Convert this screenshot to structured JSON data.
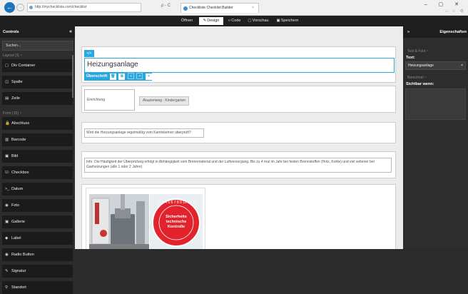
{
  "browser": {
    "url": "http://mychecklists.com/checklist",
    "address_tools": "ρ - C",
    "tab_title": "Checkliste Checklist Builder",
    "tab_close": "×",
    "window_controls": "–  ▢  ✕",
    "chrome_icons": "⌂ ☆ ⚙"
  },
  "toolbar": {
    "open": "Öffnen",
    "design": "Design",
    "code": "Code",
    "preview": "Vorschau",
    "save": "Speichern",
    "active": "design"
  },
  "left_panel": {
    "title": "Controls",
    "collapse": "«",
    "search_placeholder": "Suchen...",
    "layout_group": "Layout (3) ~",
    "layout_items": [
      {
        "icon": "div-container-icon",
        "glyph": "▢",
        "label": "Div Container"
      },
      {
        "icon": "columns-icon",
        "glyph": "◫",
        "label": "Spalte"
      },
      {
        "icon": "row-icon",
        "glyph": "▤",
        "label": "Zeile"
      }
    ],
    "form_group": "Form (15) ~",
    "form_items": [
      {
        "icon": "lock-icon",
        "glyph": "🔒",
        "label": "Abschluss"
      },
      {
        "icon": "barcode-icon",
        "glyph": "▥",
        "label": "Barcode"
      },
      {
        "icon": "image-icon",
        "glyph": "▣",
        "label": "Bild"
      },
      {
        "icon": "checkbox-icon",
        "glyph": "☑",
        "label": "Checkbox"
      },
      {
        "icon": "terminal-icon",
        "glyph": ">_",
        "label": "Datum"
      },
      {
        "icon": "camera-icon",
        "glyph": "◉",
        "label": "Foto"
      },
      {
        "icon": "gallery-icon",
        "glyph": "▣",
        "label": "Gallerie"
      },
      {
        "icon": "tag-icon",
        "glyph": "◆",
        "label": "Label"
      },
      {
        "icon": "radio-icon",
        "glyph": "◉",
        "label": "Radio Button"
      },
      {
        "icon": "signature-icon",
        "glyph": "✎",
        "label": "Signatur"
      },
      {
        "icon": "pin-icon",
        "glyph": "⚲",
        "label": "Standort"
      }
    ]
  },
  "canvas": {
    "tag_label": "</>",
    "heading": "Heizungsanlage",
    "selection_label": "Überschrift",
    "selection_buttons": [
      "🗑",
      "⧉",
      "+",
      "+",
      "+"
    ],
    "field_label": "Einrichtung",
    "field_button": "Akazienweg - Kindergarten",
    "question": "Wird die Heizungsanlage regelmäßig vom Kaminkehrer überprüft?",
    "info": "Info: Die Häufigkeit der Überprüfung erfolgt in Abhängigkeit vom Brennmaterial und der Luftversorgung. Bis zu 4 mal im Jahr bei festen Brennstoffen (Holz, Kohle) und viel seltener bei Gasheizungen (alle 1 oder 2 Jahre)",
    "badge_text": "Sicherheits technische Kontrolle",
    "badge_numbers": "1 2 3 4 5 6 7 8 9 10 11 12",
    "badge_color": "#e3232c",
    "accent_color": "#29a8e0"
  },
  "right_panel": {
    "title": "Eigenschaften",
    "expand": "»",
    "group_text_font": "Text & Font ~",
    "text_label": "Text:",
    "text_value": "Heizungsanlage",
    "clear": "×",
    "group_calc": "Berechnet ~",
    "visible_label": "Sichtbar wenn:"
  }
}
